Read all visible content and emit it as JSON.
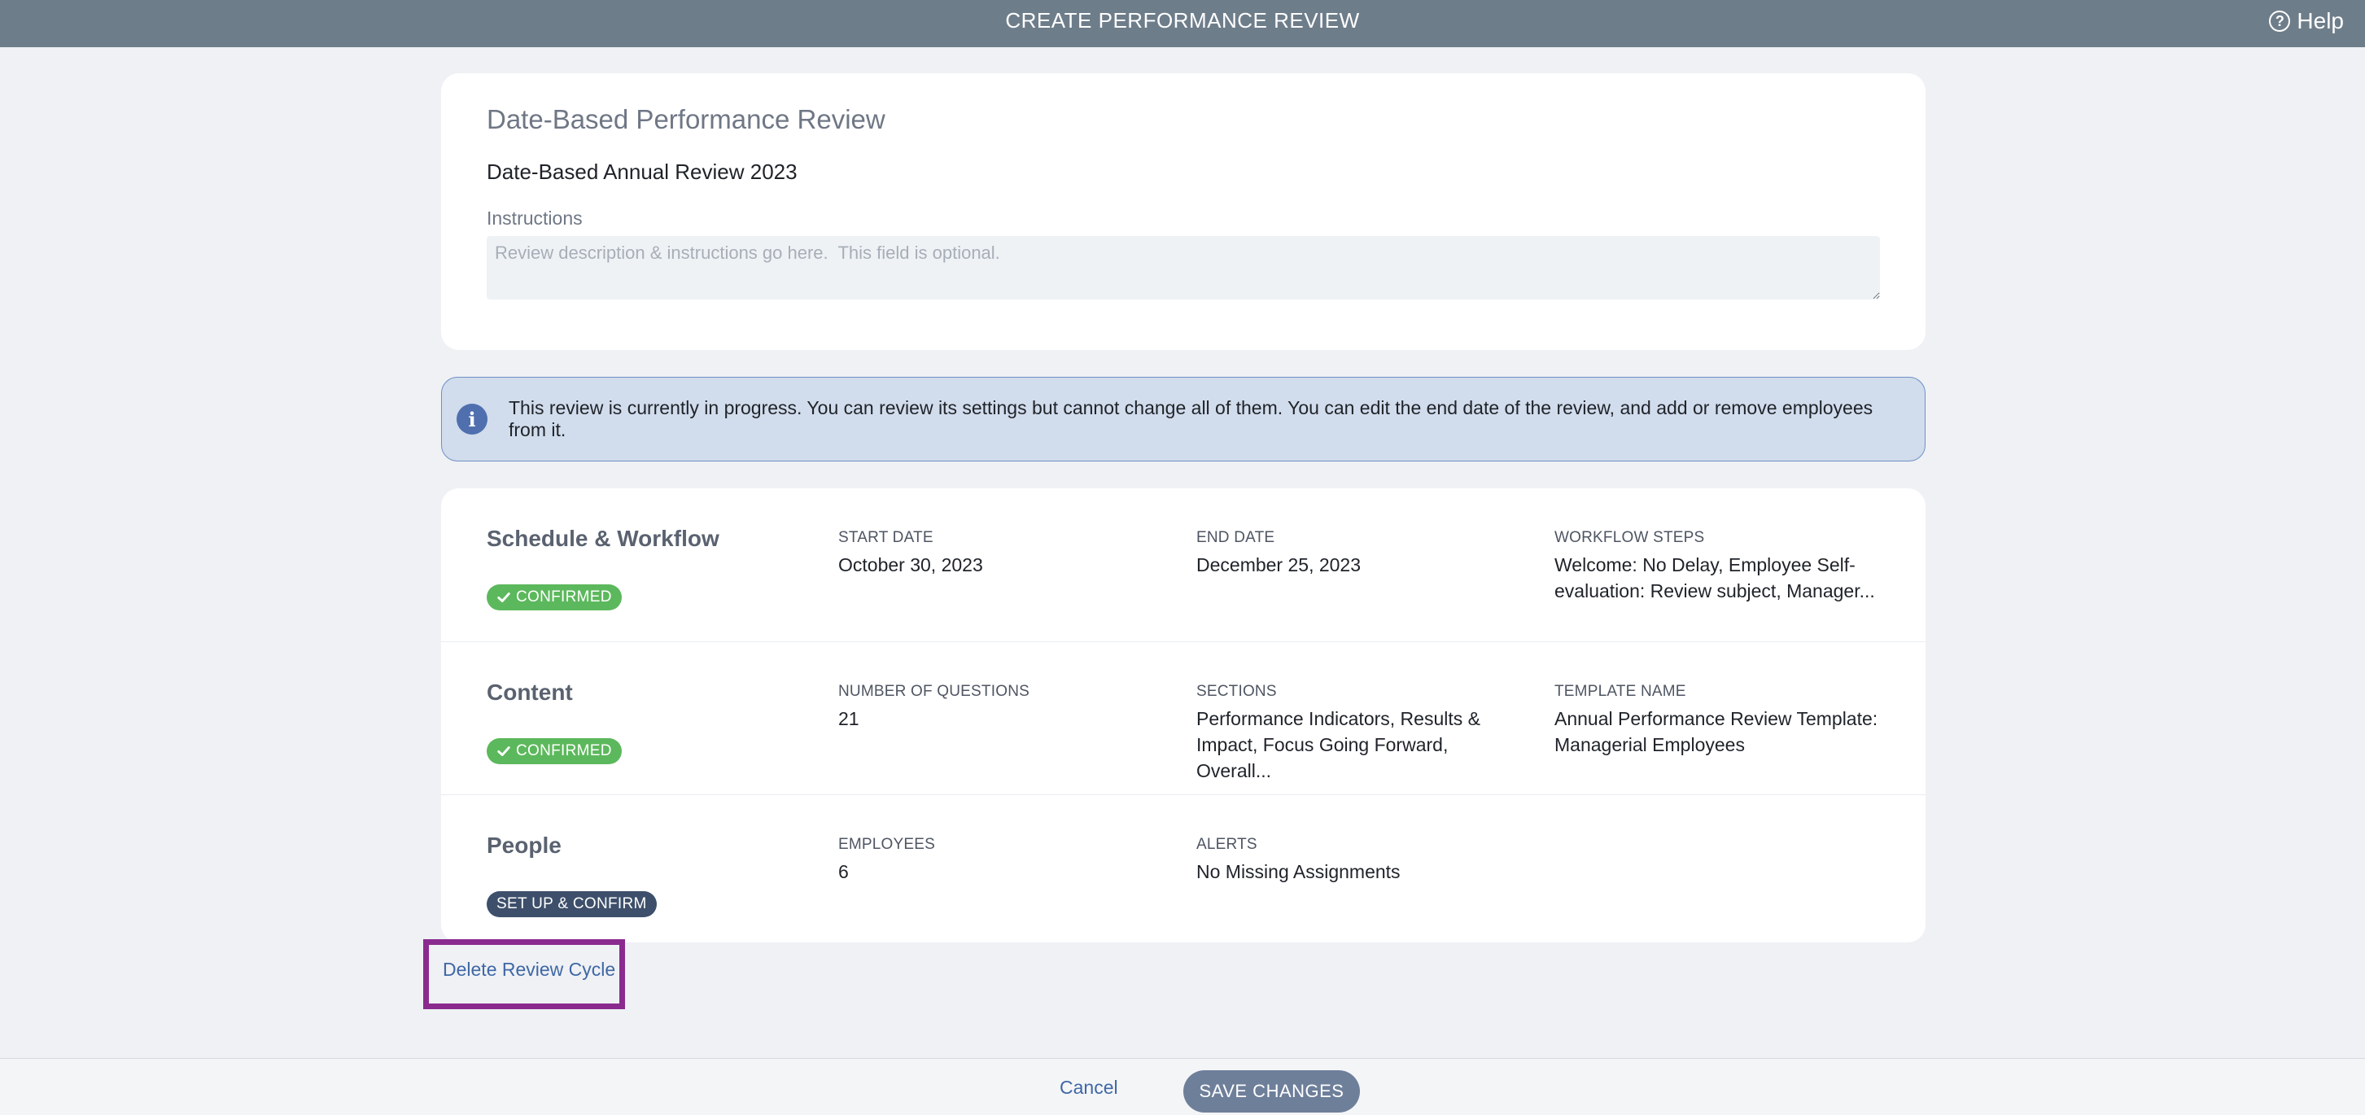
{
  "header": {
    "title": "CREATE PERFORMANCE REVIEW",
    "help_label": "Help",
    "help_icon": "question-circle-icon"
  },
  "review": {
    "type_title": "Date-Based Performance Review",
    "name": "Date-Based Annual Review 2023",
    "instructions_label": "Instructions",
    "instructions_placeholder": "Review description & instructions go here.  This field is optional.",
    "instructions_value": ""
  },
  "banner": {
    "icon": "info-icon",
    "text": "This review is currently in progress. You can review its settings but cannot change all of them. You can edit the end date of the review, and add or remove employees from it."
  },
  "sections": {
    "schedule": {
      "title": "Schedule & Workflow",
      "badge": "CONFIRMED",
      "fields": [
        {
          "label": "START DATE",
          "value": "October 30, 2023"
        },
        {
          "label": "END DATE",
          "value": "December 25, 2023"
        },
        {
          "label": "WORKFLOW STEPS",
          "value": "Welcome: No Delay, Employee Self-evaluation: Review subject, Manager..."
        }
      ]
    },
    "content": {
      "title": "Content",
      "badge": "CONFIRMED",
      "fields": [
        {
          "label": "NUMBER OF QUESTIONS",
          "value": "21"
        },
        {
          "label": "SECTIONS",
          "value": "Performance Indicators, Results & Impact, Focus Going Forward, Overall..."
        },
        {
          "label": "TEMPLATE NAME",
          "value": "Annual Performance Review Template: Managerial Employees"
        }
      ]
    },
    "people": {
      "title": "People",
      "badge": "SET UP & CONFIRM",
      "fields": [
        {
          "label": "EMPLOYEES",
          "value": "6"
        },
        {
          "label": "ALERTS",
          "value": "No Missing Assignments"
        }
      ]
    }
  },
  "actions": {
    "delete_label": "Delete Review Cycle",
    "cancel_label": "Cancel",
    "save_label": "SAVE CHANGES"
  },
  "colors": {
    "topbar": "#6e7d8a",
    "confirmed_badge": "#5cb85c",
    "setup_badge": "#3d4f6a",
    "banner_bg": "#d1dcec",
    "link": "#3f67a6",
    "highlight": "#8a2a8f"
  }
}
